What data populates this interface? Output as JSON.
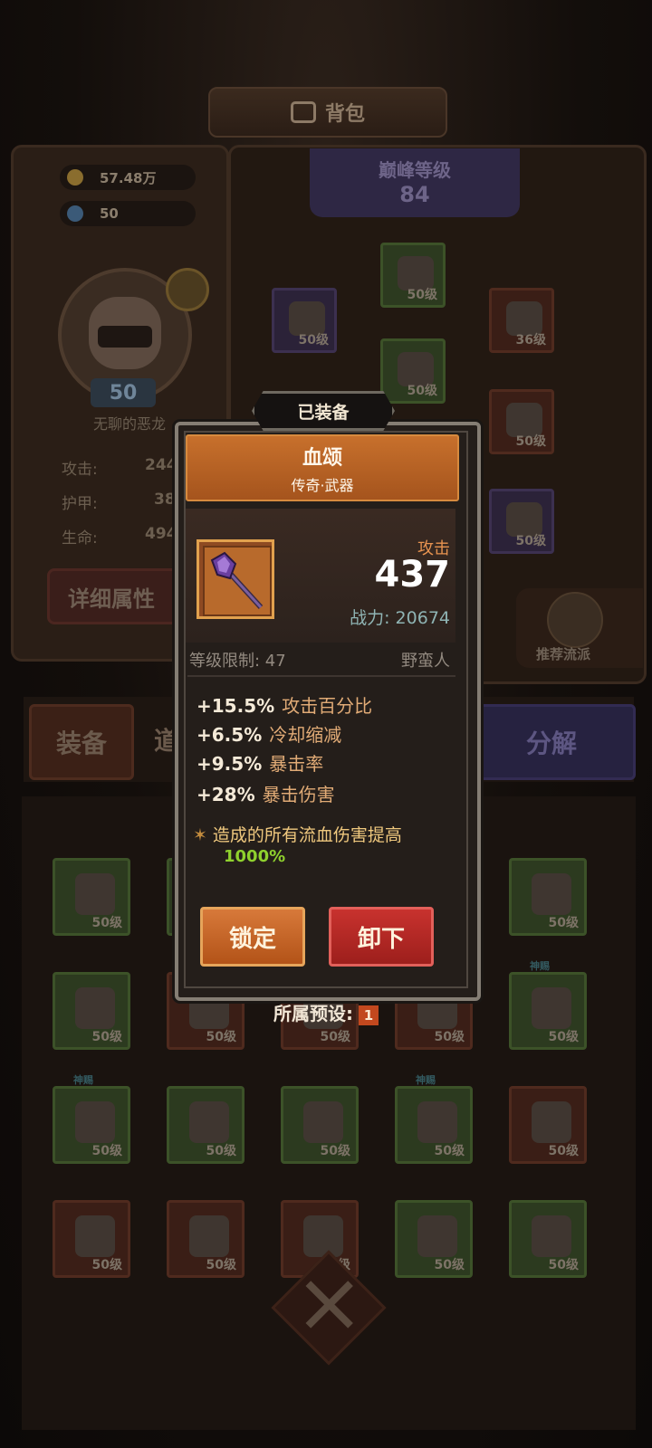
{
  "header": {
    "title": "背包"
  },
  "resources": {
    "gold": "57.48万",
    "gems": "50"
  },
  "player": {
    "level": "50",
    "name": "无聊的恶龙",
    "stats": [
      {
        "label": "攻击:",
        "value": "244"
      },
      {
        "label": "护甲:",
        "value": "38"
      },
      {
        "label": "生命:",
        "value": "494"
      }
    ],
    "detail_button": "详细属性"
  },
  "peak": {
    "label": "巅峰等级",
    "value": "84"
  },
  "equipment_slots": [
    "50级",
    "50级",
    "50级",
    "36级",
    "50级",
    "50级",
    "50级"
  ],
  "recommend": "推荐流派",
  "tabs": {
    "equip": "装备",
    "item": "道",
    "decompose": "分解"
  },
  "inventory": [
    {
      "level": "50级",
      "tag": ""
    },
    {
      "level": "50级",
      "tag": ""
    },
    {
      "level": "50级",
      "tag": ""
    },
    {
      "level": "50级",
      "tag": ""
    },
    {
      "level": "50级",
      "tag": ""
    },
    {
      "level": "50级",
      "tag": ""
    },
    {
      "level": "50级",
      "tag": ""
    },
    {
      "level": "50级",
      "tag": ""
    },
    {
      "level": "50级",
      "tag": ""
    },
    {
      "level": "50级",
      "tag": "神赐"
    },
    {
      "level": "50级",
      "tag": "神赐"
    },
    {
      "level": "50级",
      "tag": ""
    },
    {
      "level": "50级",
      "tag": ""
    },
    {
      "level": "50级",
      "tag": "神赐"
    },
    {
      "level": "50级",
      "tag": ""
    },
    {
      "level": "50级",
      "tag": ""
    },
    {
      "level": "50级",
      "tag": ""
    },
    {
      "level": "50级",
      "tag": ""
    },
    {
      "level": "50级",
      "tag": ""
    },
    {
      "level": "50级",
      "tag": ""
    }
  ],
  "popup": {
    "status": "已装备",
    "item_name": "血颂",
    "item_type": "传奇·武器",
    "main_stat_label": "攻击",
    "main_stat_value": "437",
    "power": "战力: 20674",
    "level_req": "等级限制: 47",
    "class": "野蛮人",
    "attributes": [
      {
        "value": "+15.5%",
        "name": "攻击百分比"
      },
      {
        "value": "+6.5%",
        "name": "冷却缩减"
      },
      {
        "value": "+9.5%",
        "name": "暴击率"
      },
      {
        "value": "+28%",
        "name": "暴击伤害"
      }
    ],
    "special": "造成的所有流血伤害提高",
    "special_value": "1000%",
    "lock_button": "锁定",
    "unequip_button": "卸下",
    "colors": {
      "header": "#c7702c",
      "lock": "#d7793a",
      "unequip": "#c8322e",
      "special_value": "#8fd12e"
    }
  },
  "preset": {
    "label": "所属预设:",
    "value": "1"
  }
}
